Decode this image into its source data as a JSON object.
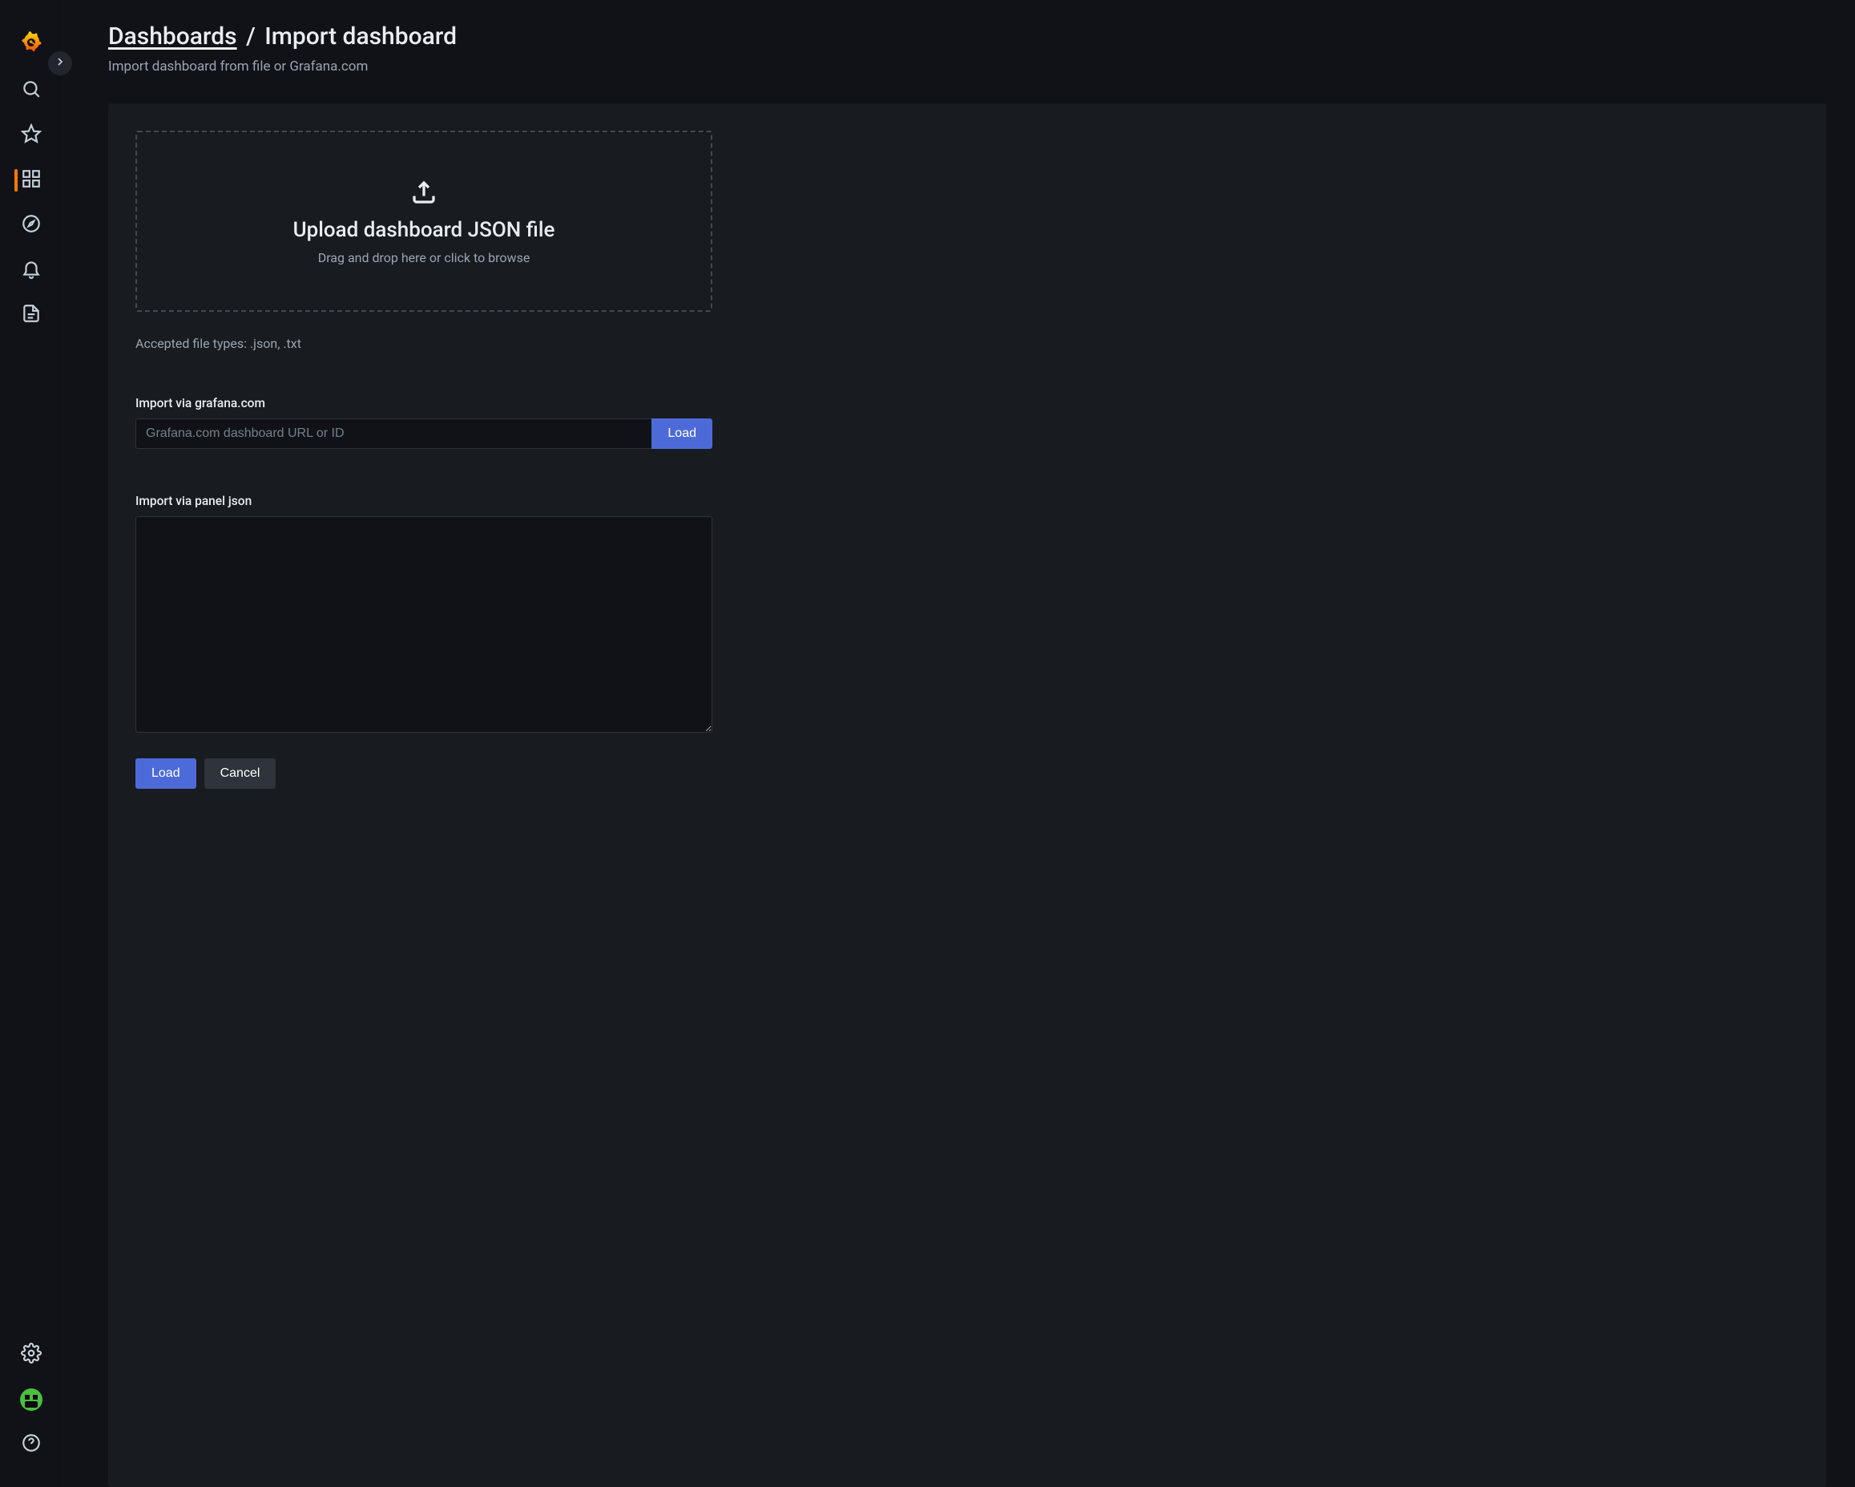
{
  "breadcrumb": {
    "parent": "Dashboards",
    "separator": "/",
    "current": "Import dashboard"
  },
  "subtitle": "Import dashboard from file or Grafana.com",
  "dropzone": {
    "title": "Upload dashboard JSON file",
    "hint": "Drag and drop here or click to browse"
  },
  "accepted_types": "Accepted file types: .json, .txt",
  "grafana_import": {
    "label": "Import via grafana.com",
    "placeholder": "Grafana.com dashboard URL or ID",
    "button": "Load"
  },
  "panel_json": {
    "label": "Import via panel json"
  },
  "actions": {
    "load": "Load",
    "cancel": "Cancel"
  },
  "sidebar": {
    "items": [
      {
        "name": "grafana-logo-icon"
      },
      {
        "name": "search-icon"
      },
      {
        "name": "star-icon"
      },
      {
        "name": "dashboards-icon",
        "active": true
      },
      {
        "name": "explore-icon"
      },
      {
        "name": "alerting-icon"
      },
      {
        "name": "pages-icon"
      }
    ],
    "bottom": [
      {
        "name": "settings-icon"
      },
      {
        "name": "avatar"
      },
      {
        "name": "help-icon"
      }
    ]
  }
}
